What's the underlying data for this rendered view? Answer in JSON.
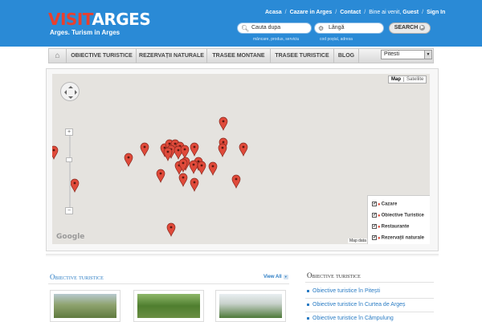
{
  "brand": {
    "logo_part1": "VISIT",
    "logo_part2": "ARGES",
    "tagline": "Arges. Turism in Arges"
  },
  "top_links": {
    "home": "Acasa",
    "lodging": "Cazare in Arges",
    "contact": "Contact",
    "welcome": "Bine ai venit,",
    "user": "Guest",
    "signin": "Sign In"
  },
  "search": {
    "what_placeholder": "Cauta dupa",
    "what_hint": "mâncare, produs, serviciu",
    "where_placeholder": "Lângă",
    "where_hint": "cod poștal, adresa",
    "button": "SEARCH"
  },
  "nav": {
    "items": [
      "OBIECTIVE TURISTICE",
      "REZERVAȚII NATURALE",
      "TRASEE MONTANE",
      "TRASEE TURISTICE",
      "BLOG"
    ],
    "city_select": "Pitesti"
  },
  "map": {
    "type_map": "Map",
    "type_satellite": "Satellite",
    "attribution": "Map data",
    "provider_logo": "Google",
    "legend": [
      "Cazare",
      "Obiective Turistice",
      "Restaurante",
      "Rezervații naturale"
    ],
    "marker_color": "#e04a3a"
  },
  "content": {
    "main_title": "Obiective turistice",
    "view_all": "View All",
    "side_title": "Obiective turistice",
    "side_links": [
      "Obiective turistice în Pitești",
      "Obiective turistice în Curtea de Argeș",
      "Obiective turistice în Câmpulung"
    ]
  },
  "colors": {
    "header_blue": "#2a8ad6",
    "link_blue": "#2a7cc4",
    "logo_red": "#e8402e"
  }
}
